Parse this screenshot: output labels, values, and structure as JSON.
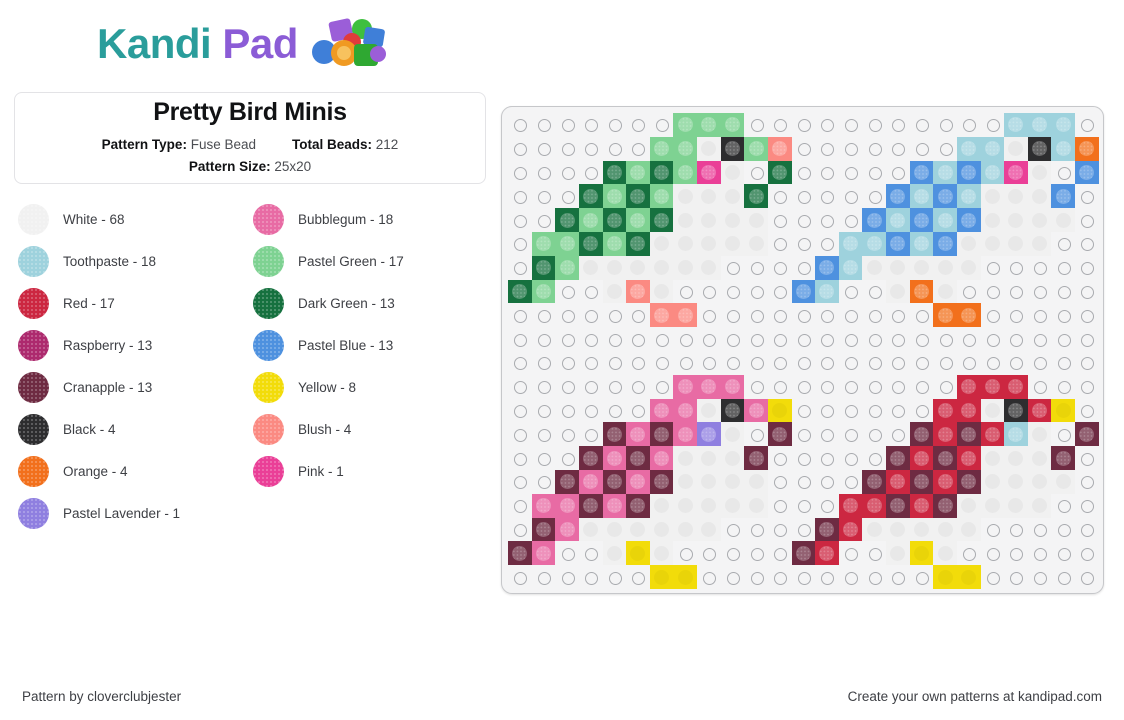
{
  "brand": {
    "name_part1": "Kandi",
    "name_part2": "Pad",
    "color_teal": "#2a9d9b",
    "color_purple": "#8b5cd6"
  },
  "pattern_info": {
    "title": "Pretty Bird Minis",
    "pattern_type_label": "Pattern Type:",
    "pattern_type_value": "Fuse Bead",
    "total_beads_label": "Total Beads:",
    "total_beads_value": "212",
    "pattern_size_label": "Pattern Size:",
    "pattern_size_value": "25x20"
  },
  "legend": [
    {
      "name": "White",
      "count": 68,
      "label": "White - 68",
      "hex": "#f1f1f1",
      "light": true
    },
    {
      "name": "Toothpaste",
      "count": 18,
      "label": "Toothpaste - 18",
      "hex": "#9ed2dd",
      "light": false
    },
    {
      "name": "Red",
      "count": 17,
      "label": "Red - 17",
      "hex": "#cc2741",
      "light": false
    },
    {
      "name": "Raspberry",
      "count": 13,
      "label": "Raspberry - 13",
      "hex": "#ad2a6e",
      "light": false
    },
    {
      "name": "Cranapple",
      "count": 13,
      "label": "Cranapple - 13",
      "hex": "#6e2b42",
      "light": false
    },
    {
      "name": "Black",
      "count": 4,
      "label": "Black - 4",
      "hex": "#2d2d2f",
      "light": false
    },
    {
      "name": "Orange",
      "count": 4,
      "label": "Orange - 4",
      "hex": "#f2701c",
      "light": false
    },
    {
      "name": "Pastel Lavender",
      "count": 1,
      "label": "Pastel Lavender - 1",
      "hex": "#8f7fe0",
      "light": false
    },
    {
      "name": "Bubblegum",
      "count": 18,
      "label": "Bubblegum - 18",
      "hex": "#e86ba4",
      "light": false
    },
    {
      "name": "Pastel Green",
      "count": 17,
      "label": "Pastel Green - 17",
      "hex": "#7ed292",
      "light": false
    },
    {
      "name": "Dark Green",
      "count": 13,
      "label": "Dark Green - 13",
      "hex": "#16713f",
      "light": false
    },
    {
      "name": "Pastel Blue",
      "count": 13,
      "label": "Pastel Blue - 13",
      "hex": "#4e91df",
      "light": false
    },
    {
      "name": "Yellow",
      "count": 8,
      "label": "Yellow - 8",
      "hex": "#f2dc0a",
      "light": true
    },
    {
      "name": "Blush",
      "count": 4,
      "label": "Blush - 4",
      "hex": "#fb8a82",
      "light": false
    },
    {
      "name": "Pink",
      "count": 1,
      "label": "Pink - 1",
      "hex": "#ea3f97",
      "light": false
    }
  ],
  "board": {
    "cols": 25,
    "rows": 20,
    "palette": {
      "W": "#f1f1f1",
      "T": "#9ed2dd",
      "R": "#cc2741",
      "S": "#ad2a6e",
      "C": "#6e2b42",
      "K": "#2d2d2f",
      "O": "#f2701c",
      "V": "#8f7fe0",
      "B": "#e86ba4",
      "G": "#7ed292",
      "D": "#16713f",
      "L": "#4e91df",
      "Y": "#f2dc0a",
      "H": "#fb8a82",
      "P": "#ea3f97"
    },
    "light_codes": [
      "W",
      "Y"
    ],
    "grid": [
      ".......GGG..............TTT..",
      "......GGWKGH.........TTWKTO",
      "....DGDGPWD.......LTLTPWL.",
      "...DGDG.W.D......LTLT.W.L.",
      "..DGDGDG..W.....LTLTL..W..",
      ".GGDGD.WWW......TTLTL..W..",
      ".DG..WWWW......LT..WWW....",
      "DG..WHW.......LT..O.......",
      "......HH...........OO....",
      "............................."
    ],
    "grid_rows": [
      [
        "e",
        "e",
        "e",
        "e",
        "e",
        "e",
        "e",
        "G",
        "G",
        "G",
        "e",
        "e",
        "e",
        "e",
        "e",
        "e",
        "e",
        "e",
        "e",
        "e",
        "e",
        "T",
        "T",
        "T",
        "e"
      ],
      [
        "e",
        "e",
        "e",
        "e",
        "e",
        "e",
        "G",
        "G",
        "W",
        "K",
        "G",
        "H",
        "e",
        "e",
        "e",
        "e",
        "e",
        "e",
        "e",
        "T",
        "T",
        "W",
        "K",
        "T",
        "O"
      ],
      [
        "e",
        "e",
        "e",
        "e",
        "D",
        "G",
        "D",
        "G",
        "P",
        "W",
        "e",
        "D",
        "e",
        "e",
        "e",
        "e",
        "e",
        "L",
        "T",
        "L",
        "T",
        "P",
        "W",
        "e",
        "L"
      ],
      [
        "e",
        "e",
        "e",
        "D",
        "G",
        "D",
        "G",
        "W",
        "W",
        "W",
        "D",
        "e",
        "e",
        "e",
        "e",
        "e",
        "L",
        "T",
        "L",
        "T",
        "W",
        "W",
        "W",
        "L",
        "e"
      ],
      [
        "e",
        "e",
        "D",
        "G",
        "D",
        "G",
        "D",
        "W",
        "W",
        "W",
        "W",
        "e",
        "e",
        "e",
        "e",
        "L",
        "T",
        "L",
        "T",
        "L",
        "W",
        "W",
        "W",
        "W",
        "e"
      ],
      [
        "e",
        "G",
        "G",
        "D",
        "G",
        "D",
        "W",
        "W",
        "W",
        "W",
        "W",
        "e",
        "e",
        "e",
        "T",
        "T",
        "L",
        "T",
        "L",
        "W",
        "W",
        "W",
        "W",
        "e",
        "e"
      ],
      [
        "e",
        "D",
        "G",
        "W",
        "W",
        "W",
        "W",
        "W",
        "W",
        "e",
        "e",
        "e",
        "e",
        "L",
        "T",
        "W",
        "W",
        "W",
        "W",
        "W",
        "e",
        "e",
        "e",
        "e",
        "e"
      ],
      [
        "D",
        "G",
        "e",
        "e",
        "W",
        "H",
        "W",
        "e",
        "e",
        "e",
        "e",
        "e",
        "L",
        "T",
        "e",
        "e",
        "W",
        "O",
        "W",
        "e",
        "e",
        "e",
        "e",
        "e",
        "e"
      ],
      [
        "e",
        "e",
        "e",
        "e",
        "e",
        "e",
        "H",
        "H",
        "e",
        "e",
        "e",
        "e",
        "e",
        "e",
        "e",
        "e",
        "e",
        "e",
        "O",
        "O",
        "e",
        "e",
        "e",
        "e",
        "e"
      ],
      [
        "e",
        "e",
        "e",
        "e",
        "e",
        "e",
        "e",
        "e",
        "e",
        "e",
        "e",
        "e",
        "e",
        "e",
        "e",
        "e",
        "e",
        "e",
        "e",
        "e",
        "e",
        "e",
        "e",
        "e",
        "e"
      ],
      [
        "e",
        "e",
        "e",
        "e",
        "e",
        "e",
        "e",
        "e",
        "e",
        "e",
        "e",
        "e",
        "e",
        "e",
        "e",
        "e",
        "e",
        "e",
        "e",
        "e",
        "e",
        "e",
        "e",
        "e",
        "e"
      ],
      [
        "e",
        "e",
        "e",
        "e",
        "e",
        "e",
        "e",
        "B",
        "B",
        "B",
        "e",
        "e",
        "e",
        "e",
        "e",
        "e",
        "e",
        "e",
        "e",
        "R",
        "R",
        "R",
        "e",
        "e",
        "e"
      ],
      [
        "e",
        "e",
        "e",
        "e",
        "e",
        "e",
        "B",
        "B",
        "W",
        "K",
        "B",
        "Y",
        "e",
        "e",
        "e",
        "e",
        "e",
        "e",
        "R",
        "R",
        "W",
        "K",
        "R",
        "Y",
        "e"
      ],
      [
        "e",
        "e",
        "e",
        "e",
        "C",
        "B",
        "C",
        "B",
        "V",
        "W",
        "e",
        "C",
        "e",
        "e",
        "e",
        "e",
        "e",
        "C",
        "R",
        "C",
        "R",
        "T",
        "W",
        "e",
        "C"
      ],
      [
        "e",
        "e",
        "e",
        "C",
        "B",
        "C",
        "B",
        "W",
        "W",
        "W",
        "C",
        "e",
        "e",
        "e",
        "e",
        "e",
        "C",
        "R",
        "C",
        "R",
        "W",
        "W",
        "W",
        "C",
        "e"
      ],
      [
        "e",
        "e",
        "C",
        "B",
        "C",
        "B",
        "C",
        "W",
        "W",
        "W",
        "W",
        "e",
        "e",
        "e",
        "e",
        "C",
        "R",
        "C",
        "R",
        "C",
        "W",
        "W",
        "W",
        "W",
        "e"
      ],
      [
        "e",
        "B",
        "B",
        "C",
        "B",
        "C",
        "W",
        "W",
        "W",
        "W",
        "W",
        "e",
        "e",
        "e",
        "R",
        "R",
        "C",
        "R",
        "C",
        "W",
        "W",
        "W",
        "W",
        "e",
        "e"
      ],
      [
        "e",
        "C",
        "B",
        "W",
        "W",
        "W",
        "W",
        "W",
        "W",
        "e",
        "e",
        "e",
        "e",
        "C",
        "R",
        "W",
        "W",
        "W",
        "W",
        "W",
        "e",
        "e",
        "e",
        "e",
        "e"
      ],
      [
        "C",
        "B",
        "e",
        "e",
        "W",
        "Y",
        "W",
        "e",
        "e",
        "e",
        "e",
        "e",
        "C",
        "R",
        "e",
        "e",
        "W",
        "Y",
        "W",
        "e",
        "e",
        "e",
        "e",
        "e",
        "e"
      ],
      [
        "e",
        "e",
        "e",
        "e",
        "e",
        "e",
        "Y",
        "Y",
        "e",
        "e",
        "e",
        "e",
        "e",
        "e",
        "e",
        "e",
        "e",
        "e",
        "Y",
        "Y",
        "e",
        "e",
        "e",
        "e",
        "e"
      ]
    ]
  },
  "footer": {
    "left": "Pattern by cloverclubjester",
    "right": "Create your own patterns at kandipad.com"
  }
}
